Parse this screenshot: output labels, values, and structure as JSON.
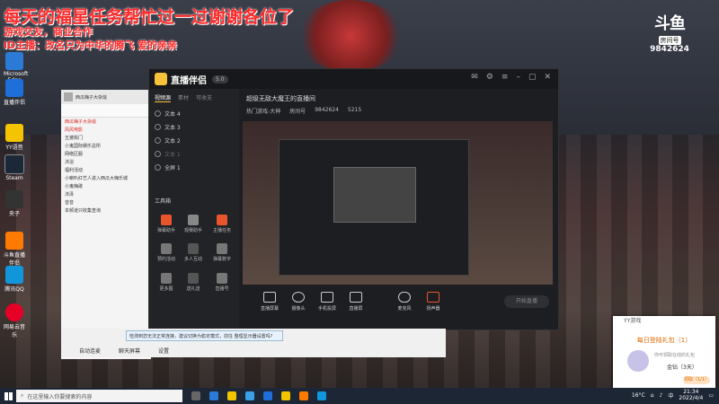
{
  "overlay": {
    "line1": "每天的福星任务帮忙过一过谢谢各位了",
    "line2": "游戏交友，商业合作",
    "line3": "ID主播：改名只为中华的腾飞 爱的亲亲"
  },
  "watermark": {
    "logo": "斗鱼",
    "tag": "房间号",
    "room": "9842624"
  },
  "desktop_icons": [
    {
      "label": "Microsoft Edge",
      "color": "#2b7bd6"
    },
    {
      "label": "直播伴侣",
      "color": "#1e6fd9"
    },
    {
      "label": "YY语音",
      "color": "#f4c400"
    },
    {
      "label": "Steam",
      "color": "#1b2838"
    },
    {
      "label": "央子",
      "color": "#333"
    },
    {
      "label": "斗鱼直播伴侣",
      "color": "#ff7a00"
    },
    {
      "label": "腾讯QQ",
      "color": "#1296db"
    },
    {
      "label": "网易云音乐",
      "color": "#e60026"
    }
  ],
  "yy_client": {
    "title": "西瓜嗨子大杂烩",
    "items": [
      "西瓜嗨子大杂烩",
      "风风电影",
      "五婆街门",
      "小鬼国际娱乐总所",
      "网络区服",
      "沐浴",
      "福利活动",
      "小喇叭红艺人进入西瓜大嗨乐城",
      "小鬼嗨歌",
      "沐泽",
      "音音",
      "本频道只收集查询"
    ]
  },
  "app": {
    "brand": "直播伴侣",
    "version": "5.0",
    "tabs": [
      "视频源",
      "素材",
      "可收支"
    ],
    "sources": [
      "文本 4",
      "文本 3",
      "文本 2",
      "文本 1",
      "全屏 1"
    ],
    "tools_title": "工具箱",
    "tools": [
      "弹幕助手",
      "观赛助手",
      "主播任务",
      "预约活动",
      "多人互动",
      "弹幕数字",
      "更多图",
      "送礼送",
      "直播号"
    ],
    "stream_title": "超级无敌大魔王的直播间",
    "stream_subtitle": "热门游戏-大神",
    "room_label": "房间号",
    "room_number": "9842624",
    "fans": "5215",
    "bottom": [
      "直播屏幕",
      "摄像头",
      "手机投屏",
      "直播屏",
      "麦克风",
      "扬声器"
    ],
    "go_live": "开始直播"
  },
  "notice": "检测到您无法正常连接，建议切换为稳定模式，前往 整理显示器设置吗?",
  "chatbar": {
    "labels": [
      "自动连麦",
      "聊天屏幕",
      "设置"
    ]
  },
  "popup": {
    "header": "YY游戏",
    "title": "每日登陆礼包（1）",
    "line": "你可领取在线的礼包",
    "gift": "金钻（3天）",
    "button": "领取（1/1）"
  },
  "taskbar": {
    "search_placeholder": "在这里输入你要搜索的内容",
    "temperature": "16°C",
    "ime": "中",
    "time": "21:34",
    "date": "2022/4/4"
  }
}
